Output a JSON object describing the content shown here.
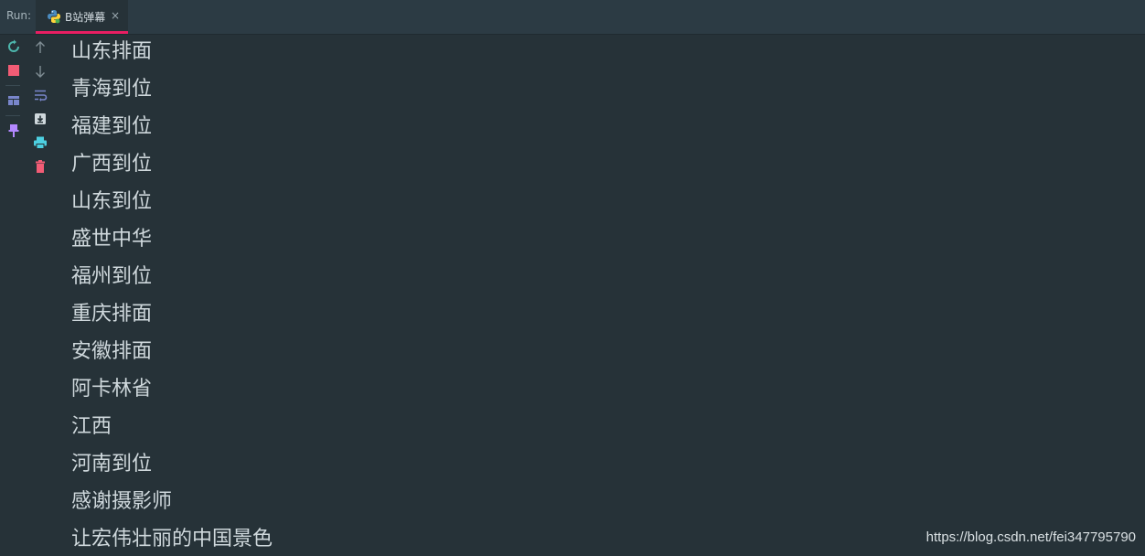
{
  "run_panel": {
    "label": "Run:",
    "tab": {
      "title": "B站弹幕",
      "close_glyph": "×"
    }
  },
  "left_toolbar": [
    {
      "name": "rerun-icon",
      "color": "#4db6ac"
    },
    {
      "name": "stop-icon",
      "color": "#f25c75"
    },
    {
      "name": "layout-icon",
      "color": "#7986cb"
    },
    {
      "name": "pin-icon",
      "color": "#b388ff"
    }
  ],
  "second_toolbar": [
    {
      "name": "scroll-up-icon",
      "color": "#7f8d94"
    },
    {
      "name": "scroll-down-icon",
      "color": "#7f8d94"
    },
    {
      "name": "soft-wrap-icon",
      "color": "#7986cb"
    },
    {
      "name": "scroll-to-end-icon",
      "color": "#cfd8dc"
    },
    {
      "name": "print-icon",
      "color": "#4dd0e1"
    },
    {
      "name": "clear-icon",
      "color": "#f25c75"
    }
  ],
  "console_lines": [
    "山东排面",
    "青海到位",
    "福建到位",
    "广西到位",
    "山东到位",
    "盛世中华",
    "福州到位",
    "重庆排面",
    "安徽排面",
    "阿卡林省",
    "江西",
    "河南到位",
    "感谢摄影师",
    "让宏伟壮丽的中国景色"
  ],
  "watermark": "https://blog.csdn.net/fei347795790"
}
